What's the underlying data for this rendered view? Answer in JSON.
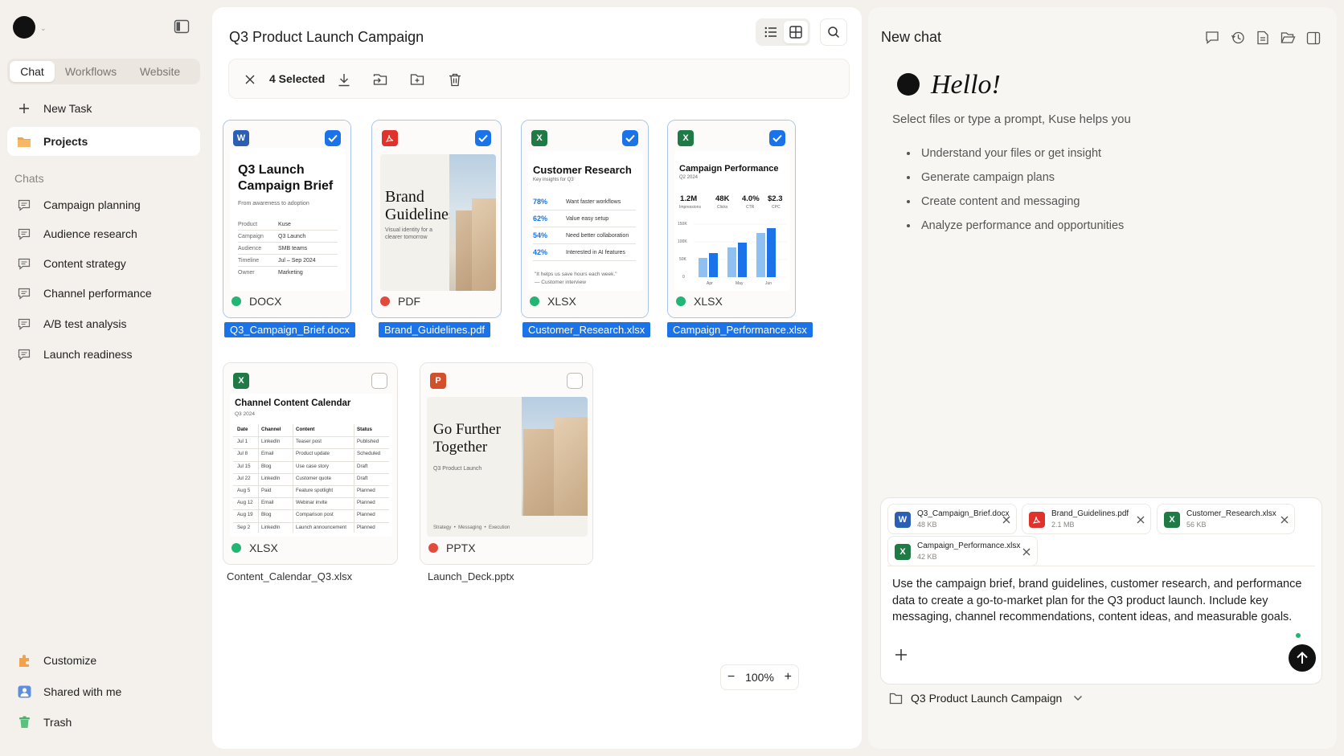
{
  "sidebar": {
    "tabs": [
      "Chat",
      "Workflows",
      "Website"
    ],
    "new_task": "New Task",
    "projects": "Projects",
    "chats_heading": "Chats",
    "chats": [
      "Campaign planning",
      "Audience research",
      "Content strategy",
      "Channel performance",
      "A/B test analysis",
      "Launch readiness"
    ],
    "bottom": [
      "Customize",
      "Shared with me",
      "Trash"
    ]
  },
  "main": {
    "title": "Q3 Product Launch Campaign",
    "selection": {
      "count_label": "4 Selected"
    },
    "zoom": "100%",
    "files": [
      {
        "name": "Q3_Campaign_Brief.docx",
        "type": "DOCX",
        "selected": true
      },
      {
        "name": "Brand_Guidelines.pdf",
        "type": "PDF",
        "selected": true
      },
      {
        "name": "Customer_Research.xlsx",
        "type": "XLSX",
        "selected": true
      },
      {
        "name": "Campaign_Performance.xlsx",
        "type": "XLSX",
        "selected": true
      },
      {
        "name": "Content_Calendar_Q3.xlsx",
        "type": "XLSX",
        "selected": false
      },
      {
        "name": "Launch_Deck.pptx",
        "type": "PPTX",
        "selected": false
      }
    ],
    "previews": {
      "brief": {
        "title": "Q3 Launch Campaign Brief",
        "subtitle": "From awareness to adoption",
        "rows": [
          [
            "Product",
            "Kuse"
          ],
          [
            "Campaign",
            "Q3 Launch"
          ],
          [
            "Audience",
            "SMB teams"
          ],
          [
            "Timeline",
            "Jul – Sep 2024"
          ],
          [
            "Owner",
            "Marketing"
          ]
        ]
      },
      "brand": {
        "title": "Brand Guidelines",
        "subtitle": "Visual identity for a clearer tomorrow"
      },
      "research": {
        "title": "Customer Research",
        "subtitle": "Key insights for Q3",
        "stats": [
          [
            "78%",
            "Want faster workflows"
          ],
          [
            "62%",
            "Value easy setup"
          ],
          [
            "54%",
            "Need better collaboration"
          ],
          [
            "42%",
            "Interested in AI features"
          ]
        ],
        "quote": "\"It helps us save hours each week.\"",
        "quote_by": "— Customer interview"
      },
      "performance": {
        "title": "Campaign Performance",
        "subtitle": "Q2 2024",
        "kpis": [
          [
            "1.2M",
            "Impressions"
          ],
          [
            "48K",
            "Clicks"
          ],
          [
            "4.0%",
            "CTR"
          ],
          [
            "$2.3",
            "CPC"
          ]
        ],
        "y_ticks": [
          "150K",
          "100K",
          "50K",
          "0"
        ],
        "x_ticks": [
          "Apr",
          "May",
          "Jun"
        ]
      },
      "calendar": {
        "title": "Channel Content Calendar",
        "subtitle": "Q3 2024",
        "headers": [
          "Date",
          "Channel",
          "Content",
          "Status"
        ],
        "rows": [
          [
            "Jul 1",
            "LinkedIn",
            "Teaser post",
            "Published"
          ],
          [
            "Jul 8",
            "Email",
            "Product update",
            "Scheduled"
          ],
          [
            "Jul 15",
            "Blog",
            "Use case story",
            "Draft"
          ],
          [
            "Jul 22",
            "LinkedIn",
            "Customer quote",
            "Draft"
          ],
          [
            "Aug 5",
            "Paid",
            "Feature spotlight",
            "Planned"
          ],
          [
            "Aug 12",
            "Email",
            "Webinar invite",
            "Planned"
          ],
          [
            "Aug 19",
            "Blog",
            "Comparison post",
            "Planned"
          ],
          [
            "Sep 2",
            "LinkedIn",
            "Launch announcement",
            "Planned"
          ]
        ]
      },
      "deck": {
        "title": "Go Further Together",
        "subtitle": "Q3 Product Launch",
        "footer": [
          "Strategy",
          "Messaging",
          "Execution"
        ]
      }
    }
  },
  "chat": {
    "title": "New chat",
    "greeting": "Hello!",
    "subtitle": "Select files or type a prompt, Kuse helps you",
    "bullets": [
      "Understand your files or get insight",
      "Generate campaign plans",
      "Create content and messaging",
      "Analyze performance and opportunities"
    ],
    "attachments": [
      {
        "name": "Q3_Campaign_Brief.docx",
        "size": "48 KB"
      },
      {
        "name": "Brand_Guidelines.pdf",
        "size": "2.1 MB"
      },
      {
        "name": "Customer_Research.xlsx",
        "size": "56 KB"
      },
      {
        "name": "Campaign_Performance.xlsx",
        "size": "42 KB"
      }
    ],
    "prompt": "Use the campaign brief, brand guidelines, customer research, and performance data to create a go-to-market plan for the Q3 product launch. Include key messaging, channel recommendations, content ideas, and measurable goals.",
    "project": "Q3 Product Launch Campaign"
  },
  "colors": {
    "accent": "#1a73e8",
    "word": "#2b5fb4",
    "pdf": "#e0312b",
    "excel": "#1f7a45",
    "ppt": "#d2502b",
    "dot_green": "#22b573",
    "dot_red": "#e24a3b"
  }
}
